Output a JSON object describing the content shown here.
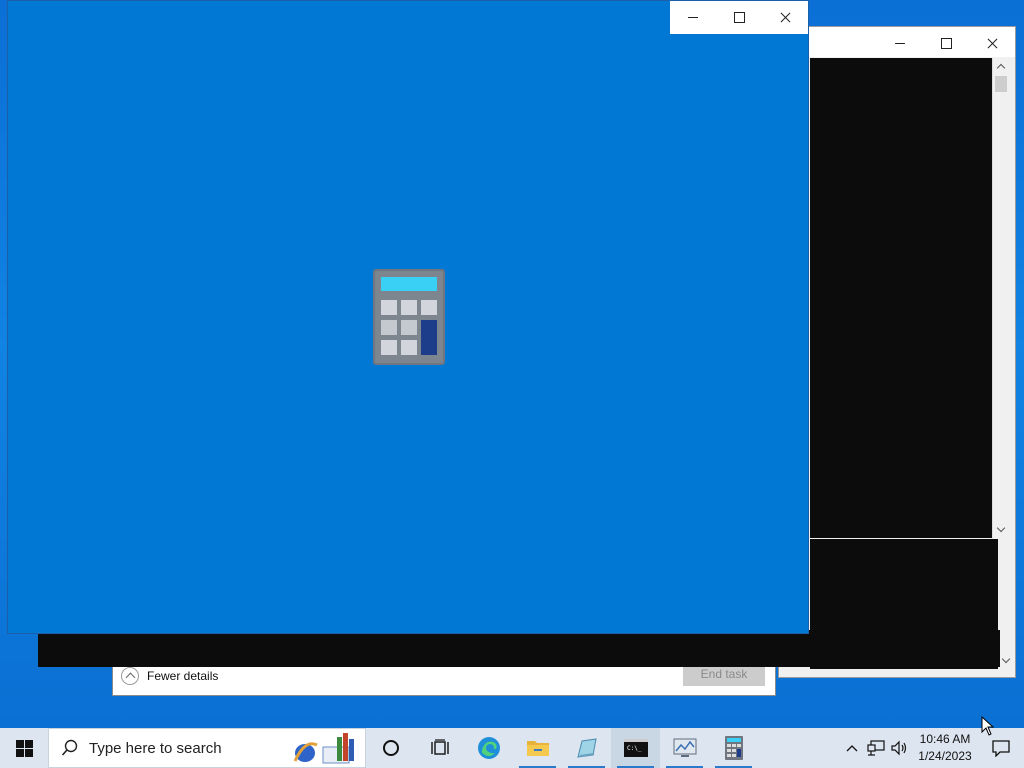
{
  "task_manager": {
    "fewer_details_label": "Fewer details",
    "end_task_label": "End task"
  },
  "calculator_window": {
    "minimize_label": "",
    "maximize_label": "",
    "close_label": "",
    "icon": "calculator-icon",
    "background_color": "#0078d4"
  },
  "console_window": {
    "icon": "console-window"
  },
  "taskbar": {
    "start_icon": "windows-logo-icon",
    "search_placeholder": "Type here to search",
    "pinned": [
      {
        "name": "cortana",
        "icon": "circle-icon"
      },
      {
        "name": "task-view",
        "icon": "task-view-icon"
      },
      {
        "name": "edge",
        "icon": "edge-icon"
      },
      {
        "name": "file-explorer",
        "icon": "folder-icon"
      },
      {
        "name": "paint",
        "icon": "paint-icon"
      },
      {
        "name": "command-prompt",
        "icon": "cmd-icon"
      },
      {
        "name": "resource-monitor",
        "icon": "monitor-icon"
      },
      {
        "name": "calculator",
        "icon": "calculator-icon"
      }
    ],
    "time": "10:46 AM",
    "date": "1/24/2023"
  }
}
